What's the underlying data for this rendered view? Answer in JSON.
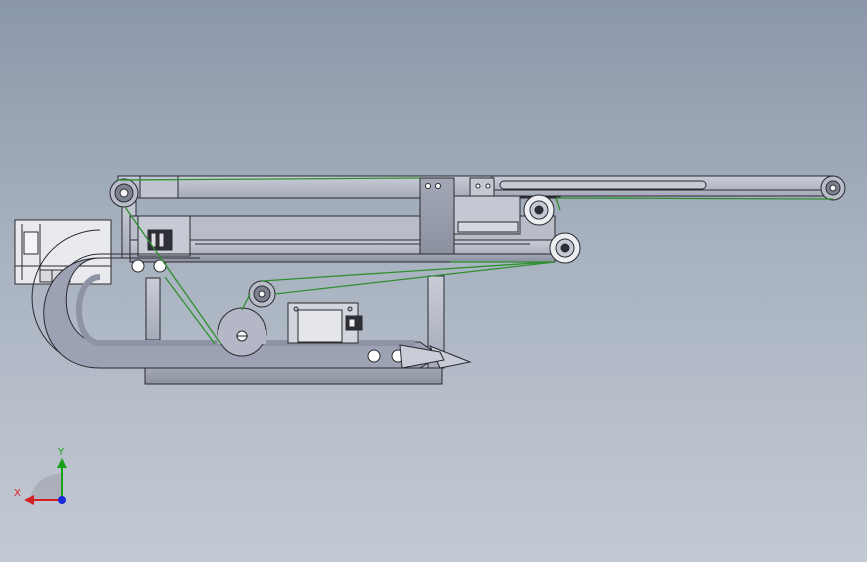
{
  "scene": {
    "background_top": "#8b98a9",
    "background_bottom": "#c4cad4",
    "part_fill": "#b4b8c6",
    "part_fill_light": "#c8ccd6",
    "part_fill_dark": "#9a9fae",
    "edge_color": "#2a2a30",
    "belt_color": "#2f8f2f"
  },
  "triad": {
    "x_label": "X",
    "y_label": "Y",
    "x_color": "#d42020",
    "y_color": "#18a018",
    "z_color": "#1a2ad8"
  }
}
